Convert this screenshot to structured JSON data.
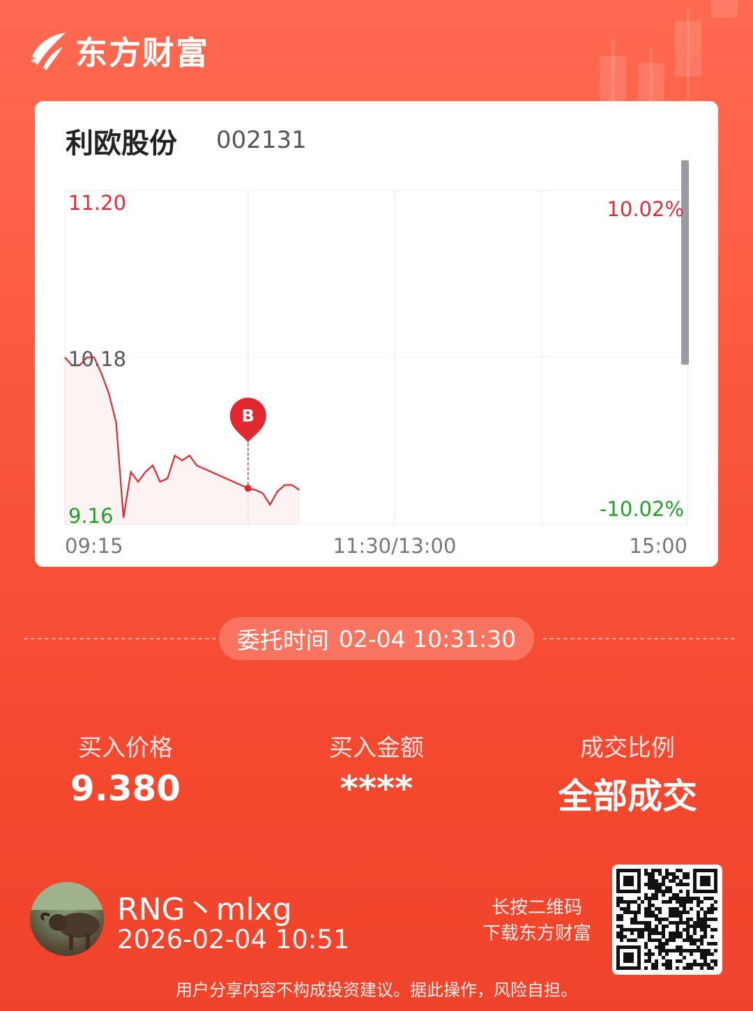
{
  "brand": {
    "name": "东方财富"
  },
  "stock": {
    "name": "利欧股份",
    "code": "002131"
  },
  "chart_data": {
    "type": "line",
    "x_ticks": [
      "09:15",
      "11:30/13:00",
      "15:00"
    ],
    "y_ticks_left": [
      "11.20",
      "10.18",
      "9.16"
    ],
    "y_ticks_right": [
      "10.02%",
      "-10.02%"
    ],
    "ylim": [
      9.16,
      11.2
    ],
    "x": [
      "09:15",
      "09:18",
      "09:21",
      "09:24",
      "09:27",
      "09:30",
      "09:33",
      "09:36",
      "09:39",
      "09:42",
      "09:45",
      "09:48",
      "09:51",
      "09:54",
      "09:57",
      "10:00",
      "10:03",
      "10:06",
      "10:09",
      "10:12",
      "10:15",
      "10:18",
      "10:21",
      "10:24",
      "10:27",
      "10:30",
      "10:33",
      "10:36",
      "10:39",
      "10:42",
      "10:45",
      "10:48",
      "10:51"
    ],
    "values": [
      10.18,
      10.13,
      10.13,
      10.18,
      10.18,
      10.08,
      9.96,
      9.78,
      9.2,
      9.48,
      9.42,
      9.48,
      9.52,
      9.42,
      9.44,
      9.58,
      9.55,
      9.58,
      9.52,
      9.5,
      9.48,
      9.46,
      9.44,
      9.42,
      9.4,
      9.38,
      9.37,
      9.35,
      9.28,
      9.36,
      9.4,
      9.4,
      9.37
    ],
    "marker": {
      "label": "B",
      "time": "10:30",
      "price": 9.38
    }
  },
  "order": {
    "time_label": "委托时间",
    "time_value": "02-04 10:31:30"
  },
  "stats": [
    {
      "label": "买入价格",
      "value": "9.380"
    },
    {
      "label": "买入金额",
      "value": "****"
    },
    {
      "label": "成交比例",
      "value": "全部成交"
    }
  ],
  "user": {
    "name": "RNG丶mlxg",
    "datetime": "2026-02-04 10:51"
  },
  "qr_hint": {
    "line1": "长按二维码",
    "line2": "下载东方财富"
  },
  "disclaimer": "用户分享内容不构成投资建议。据此操作，风险自担。",
  "colors": {
    "up": "#d8303a",
    "down": "#22a02a",
    "line": "#e0282e"
  }
}
